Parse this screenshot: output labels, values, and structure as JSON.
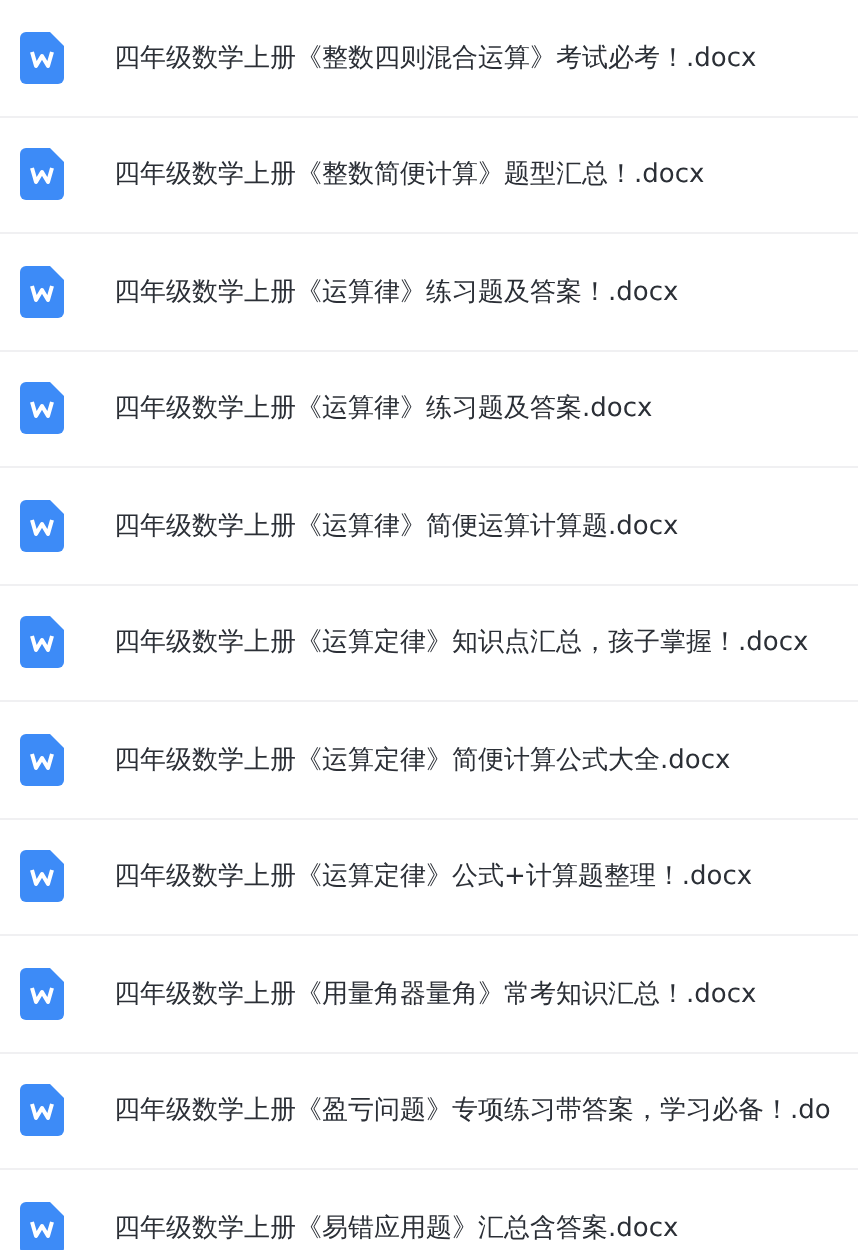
{
  "files": [
    {
      "name": "四年级数学上册《整数四则混合运算》考试必考！.docx"
    },
    {
      "name": "四年级数学上册《整数简便计算》题型汇总！.docx"
    },
    {
      "name": "四年级数学上册《运算律》练习题及答案！.docx"
    },
    {
      "name": "四年级数学上册《运算律》练习题及答案.docx"
    },
    {
      "name": "四年级数学上册《运算律》简便运算计算题.docx"
    },
    {
      "name": "四年级数学上册《运算定律》知识点汇总，孩子掌握！.docx"
    },
    {
      "name": "四年级数学上册《运算定律》简便计算公式大全.docx"
    },
    {
      "name": "四年级数学上册《运算定律》公式+计算题整理！.docx"
    },
    {
      "name": "四年级数学上册《用量角器量角》常考知识汇总！.docx"
    },
    {
      "name": "四年级数学上册《盈亏问题》专项练习带答案，学习必备！.do"
    },
    {
      "name": "四年级数学上册《易错应用题》汇总含答案.docx"
    }
  ]
}
